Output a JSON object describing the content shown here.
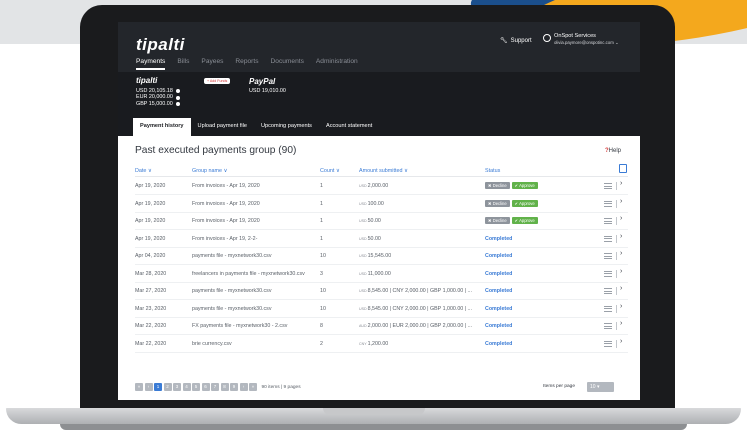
{
  "app": {
    "logo": "tipalti",
    "nav": [
      "Payments",
      "Bills",
      "Payees",
      "Reports",
      "Documents",
      "Administration"
    ],
    "support": "Support",
    "account_name": "OnSpot Services",
    "account_email": "olivia.paymore@onspotinc.com"
  },
  "balance": {
    "logo": "tipalti",
    "add_funds": "+ Add Funds",
    "lines": [
      "USD 20,105.18",
      "EUR 20,000.00",
      "GBP 15,000.00"
    ],
    "paypal": "PayPal",
    "paypal_amount": "USD 19,010.00"
  },
  "tabs": [
    "Payment history",
    "Upload payment file",
    "Upcoming payments",
    "Account statement"
  ],
  "panel": {
    "title": "Past executed payments group (90)",
    "help": "Help"
  },
  "table": {
    "columns": [
      "Date",
      "Group name",
      "Count",
      "Amount submitted",
      "Status"
    ],
    "decline_label": "Decline",
    "approve_label": "Approve",
    "rows": [
      {
        "date": "Apr 19, 2020",
        "group": "From invoices - Apr 19, 2020",
        "count": "1",
        "cur": "USD",
        "amount": "2,000.00",
        "status": "",
        "pending": true
      },
      {
        "date": "Apr 19, 2020",
        "group": "From invoices - Apr 19, 2020",
        "count": "1",
        "cur": "USD",
        "amount": "100.00",
        "status": "",
        "pending": true
      },
      {
        "date": "Apr 19, 2020",
        "group": "From invoices - Apr 19, 2020",
        "count": "1",
        "cur": "USD",
        "amount": "50.00",
        "status": "",
        "pending": true
      },
      {
        "date": "Apr 19, 2020",
        "group": "From invoices - Apr 19, 2-2-",
        "count": "1",
        "cur": "USD",
        "amount": "50.00",
        "status": "Completed",
        "pending": false
      },
      {
        "date": "Apr 04, 2020",
        "group": "payments file - myxnetwork30.csv",
        "count": "10",
        "cur": "USD",
        "amount": "15,545.00",
        "status": "Completed",
        "pending": false
      },
      {
        "date": "Mar 28, 2020",
        "group": "freelancers in payments file - myxnetwork30.csv",
        "count": "3",
        "cur": "USD",
        "amount": "11,000.00",
        "status": "Completed",
        "pending": false
      },
      {
        "date": "Mar 27, 2020",
        "group": "payments file - myxnetwork30.csv",
        "count": "10",
        "cur": "USD",
        "amount": "8,545.00 | CNY 2,000.00 | GBP 1,000.00 | ...",
        "status": "Completed",
        "pending": false
      },
      {
        "date": "Mar 23, 2020",
        "group": "payments file - myxnetwork30.csv",
        "count": "10",
        "cur": "USD",
        "amount": "8,545.00 | CNY 2,000.00 | GBP 1,000.00 | ...",
        "status": "Completed",
        "pending": false
      },
      {
        "date": "Mar 22, 2020",
        "group": "FX payments file - myxnetwork30 - 2.csv",
        "count": "8",
        "cur": "AUD",
        "amount": "2,000.00 | EUR 2,000.00 | GBP 2,000.00 | ...",
        "status": "Completed",
        "pending": false
      },
      {
        "date": "Mar 22, 2020",
        "group": "brie currency.csv",
        "count": "2",
        "cur": "CNY",
        "amount": "1,200.00",
        "status": "Completed",
        "pending": false
      }
    ]
  },
  "pager": {
    "first": "«",
    "prev": "‹",
    "pages": [
      "1",
      "2",
      "3",
      "4",
      "5",
      "6",
      "7",
      "8",
      "9"
    ],
    "next": "›",
    "last": "»",
    "info": "90 items | 9 pages",
    "items_per_page_label": "Items per page",
    "items_per_page_value": "10"
  }
}
